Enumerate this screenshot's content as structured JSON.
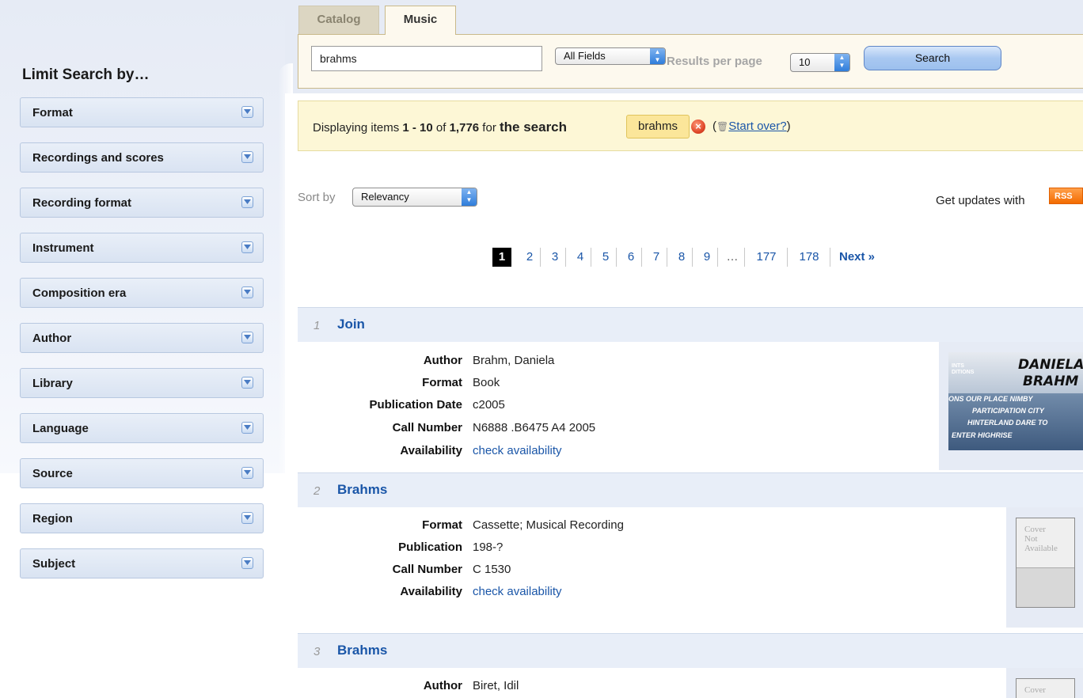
{
  "sidebar": {
    "title": "Limit Search by…",
    "facets": [
      {
        "label": "Format"
      },
      {
        "label": "Recordings and scores"
      },
      {
        "label": "Recording format"
      },
      {
        "label": "Instrument"
      },
      {
        "label": "Composition era"
      },
      {
        "label": "Author"
      },
      {
        "label": "Library"
      },
      {
        "label": "Language"
      },
      {
        "label": "Source"
      },
      {
        "label": "Region"
      },
      {
        "label": "Subject"
      }
    ]
  },
  "tabs": [
    {
      "label": "Catalog",
      "active": false
    },
    {
      "label": "Music",
      "active": true
    }
  ],
  "search": {
    "query": "brahms",
    "field_selected": "All Fields",
    "results_per_page_label": "Results per page",
    "results_per_page_value": "10",
    "button_label": "Search"
  },
  "summary": {
    "prefix": "Displaying items ",
    "range": "1 - 10",
    "of": " of ",
    "total": "1,776",
    "for": " for ",
    "the_search": "the search",
    "query_chip": "brahms",
    "startover_open": "(",
    "startover_link": "Start over?",
    "startover_close": ")"
  },
  "sort": {
    "label": "Sort by",
    "selected": "Relevancy"
  },
  "rss": {
    "text": "Get updates with",
    "badge": "RSS"
  },
  "pagination": {
    "current": "1",
    "pages": [
      "2",
      "3",
      "4",
      "5",
      "6",
      "7",
      "8",
      "9",
      "…",
      "177",
      "178"
    ],
    "next": "Next »"
  },
  "results": [
    {
      "num": "1",
      "title": "Join",
      "fields": [
        {
          "label": "Author",
          "value": "Brahm, Daniela"
        },
        {
          "label": "Format",
          "value": "Book"
        },
        {
          "label": "Publication Date",
          "value": "c2005"
        },
        {
          "label": "Call Number",
          "value": "N6888 .B6475 A4 2005"
        },
        {
          "label": "Availability",
          "value": "check availability"
        }
      ],
      "cover": {
        "line1": "DANIELA",
        "line2": "BRAHM",
        "small1": "ONS OUR PLACE NIMBY",
        "small2": "PARTICIPATION CITY",
        "small3": "HINTERLAND DARE TO",
        "small4": "ENTER HIGHRISE",
        "corner1": "INTS",
        "corner2": "DITIONS"
      }
    },
    {
      "num": "2",
      "title": "Brahms",
      "fields": [
        {
          "label": "Format",
          "value": "Cassette; Musical Recording"
        },
        {
          "label": "Publication",
          "value": "198-?"
        },
        {
          "label": "Call Number",
          "value": "C 1530"
        },
        {
          "label": "Availability",
          "value": "check availability"
        }
      ],
      "cover": {
        "text1": "Cover",
        "text2": "Not",
        "text3": "Available"
      }
    },
    {
      "num": "3",
      "title": "Brahms",
      "fields": [
        {
          "label": "Author",
          "value": "Biret, Idil"
        }
      ],
      "cover": {
        "text1": "Cover"
      }
    }
  ],
  "colors": {
    "link": "#1a56a8",
    "summary_bg": "#fdf7d6",
    "tab_panel_bg": "#fdf9ee",
    "sidebar_bg": "#e6ebf5",
    "rss": "#f36b00"
  }
}
